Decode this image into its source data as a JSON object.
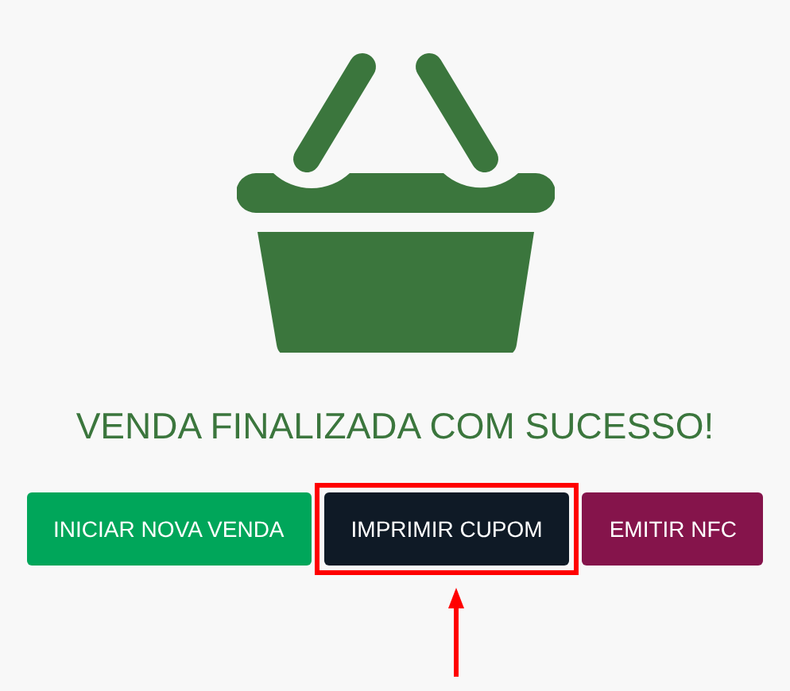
{
  "message": "VENDA FINALIZADA COM SUCESSO!",
  "buttons": [
    {
      "label": "INICIAR NOVA VENDA",
      "color": "#00a65a",
      "selected": false
    },
    {
      "label": "IMPRIMIR CUPOM",
      "color": "#0f1a26",
      "selected": true
    },
    {
      "label": "EMITIR NFC",
      "color": "#85144b",
      "selected": false
    }
  ]
}
